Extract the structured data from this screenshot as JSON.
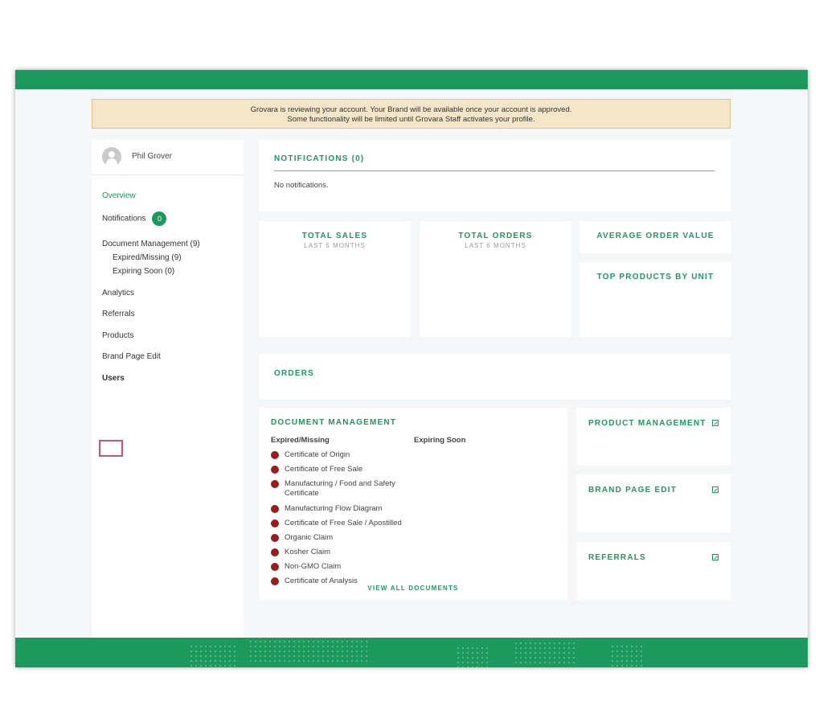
{
  "banner": {
    "line1": "Grovara is reviewing your account. Your Brand will be available once your account is approved.",
    "line2": "Some functionality will be limited until Grovara Staff activates your profile."
  },
  "sidebar": {
    "user_name": "Phil Grover",
    "overview": "Overview",
    "notifications": "Notifications",
    "notifications_count": "0",
    "document_management": "Document Management (9)",
    "expired_missing": "Expired/Missing (9)",
    "expiring_soon": "Expiring Soon (0)",
    "analytics": "Analytics",
    "referrals": "Referrals",
    "products": "Products",
    "brand_page_edit": "Brand Page Edit",
    "users": "Users"
  },
  "notifications": {
    "title": "NOTIFICATIONS (0)",
    "empty": "No notifications."
  },
  "total_sales": {
    "title": "TOTAL SALES",
    "sub": "LAST 6 MONTHS"
  },
  "total_orders": {
    "title": "TOTAL ORDERS",
    "sub": "LAST 6 MONTHS"
  },
  "average_order_value": {
    "title": "AVERAGE ORDER VALUE"
  },
  "top_products": {
    "title": "TOP PRODUCTS BY UNIT"
  },
  "orders": {
    "title": "ORDERS"
  },
  "document_management": {
    "title": "DOCUMENT MANAGEMENT",
    "col_expired": "Expired/Missing",
    "col_expiring": "Expiring Soon",
    "items": [
      "Certificate of Origin",
      "Certificate of Free Sale",
      "Manufacturing / Food and Safety Certificate",
      "Manufacturing Flow Diagram",
      "Certificate of Free Sale / Apostilled",
      "Organic Claim",
      "Kosher Claim",
      "Non-GMO Claim",
      "Certificate of Analysis"
    ],
    "view_all": "VIEW ALL DOCUMENTS"
  },
  "product_management": {
    "title": "PRODUCT MANAGEMENT"
  },
  "brand_page_edit": {
    "title": "BRAND PAGE EDIT"
  },
  "referrals": {
    "title": "REFERRALS"
  },
  "colors": {
    "brand_green": "#1c9a5e",
    "banner_bg": "#f4e6c6",
    "alert_red": "#9b1c1c",
    "highlight": "#d0527a"
  },
  "icons": {
    "avatar": "user-avatar-icon",
    "external_link": "external-link-icon",
    "status_dot": "status-dot-icon"
  }
}
